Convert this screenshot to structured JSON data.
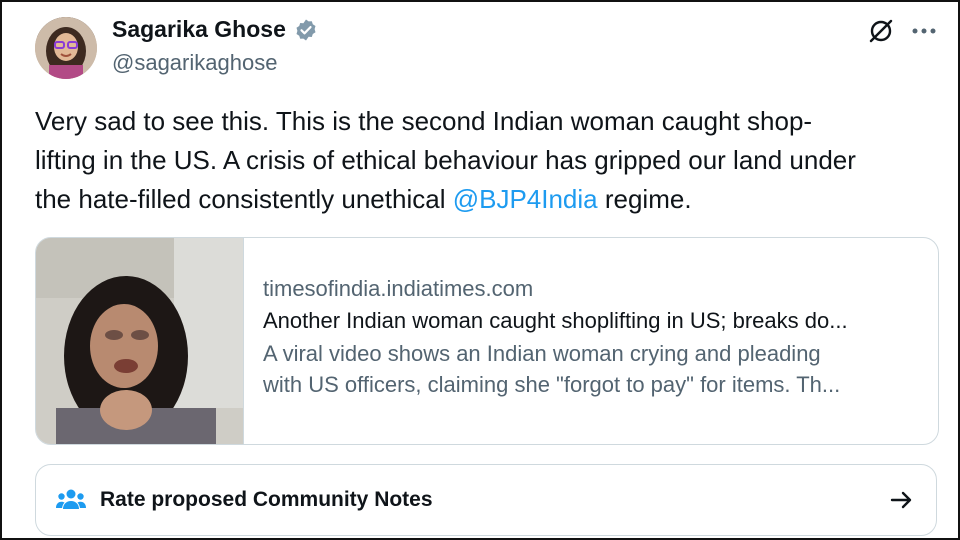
{
  "author": {
    "name": "Sagarika Ghose",
    "handle": "@sagarikaghose"
  },
  "tweet": {
    "line1": "Very sad to see this. This is the second Indian woman caught shop-",
    "line2": "lifting in the US. A crisis of ethical behaviour has gripped our land under",
    "line3_before": "the hate-filled consistently unethical ",
    "mention": "@BJP4India",
    "line3_after": " regime."
  },
  "card": {
    "domain": "timesofindia.indiatimes.com",
    "title": "Another Indian woman caught shoplifting in US; breaks do...",
    "desc_line1": "A viral video shows an Indian woman crying and pleading",
    "desc_line2": "with US officers, claiming she \"forgot to pay\" for items. Th..."
  },
  "community_notes": {
    "label": "Rate proposed Community Notes"
  },
  "icons": {
    "verified": "verified-badge-icon",
    "grok": "grok-icon",
    "more": "more-icon",
    "people": "people-icon",
    "arrow": "arrow-right-icon"
  },
  "colors": {
    "accent": "#1d9bf0",
    "secondary_text": "#536471",
    "border": "#cfd9de"
  }
}
